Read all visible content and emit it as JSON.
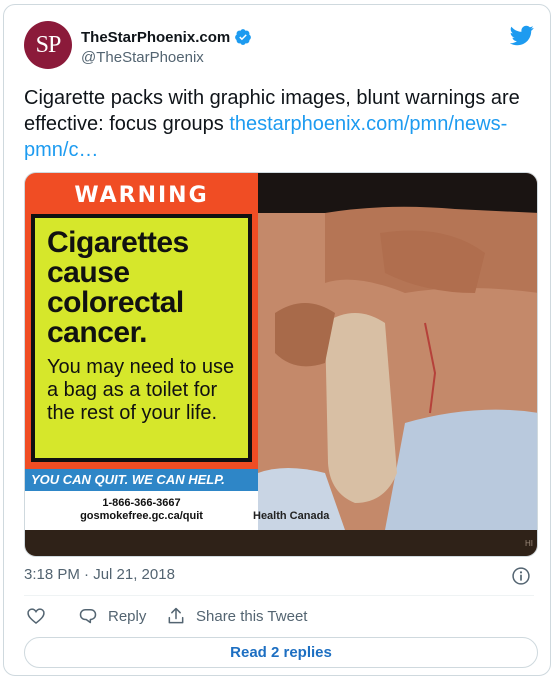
{
  "author": {
    "avatar_initials": "SP",
    "avatar_color": "#8b1a3a",
    "display_name": "TheStarPhoenix.com",
    "handle": "@TheStarPhoenix",
    "verified": true
  },
  "tweet": {
    "text": "Cigarette packs with graphic images, blunt warnings are effective: focus groups ",
    "link_text": "thestarphoenix.com/pmn/news-pmn/c…",
    "link_color": "#1d9bf0"
  },
  "media": {
    "warning_title": "WARNING",
    "headline": "Cigarettes cause colorectal cancer.",
    "body": "You may need to use a bag as a toilet for the rest of your life.",
    "quit_line": "YOU CAN QUIT. WE CAN HELP.",
    "phone": "1-866-366-3667",
    "website": "gosmokefree.gc.ca/quit",
    "credit": "Health Canada",
    "corner_mark": "HI"
  },
  "meta": {
    "timestamp": "3:18 PM · Jul 21, 2018"
  },
  "actions": {
    "reply_label": "Reply",
    "share_label": "Share this Tweet",
    "read_replies_label": "Read 2 replies"
  },
  "icons": {
    "brand": "twitter-bird-icon",
    "verified": "verified-badge-icon",
    "info": "info-icon",
    "like": "heart-icon",
    "reply": "speech-bubble-icon",
    "share": "share-upload-icon"
  }
}
